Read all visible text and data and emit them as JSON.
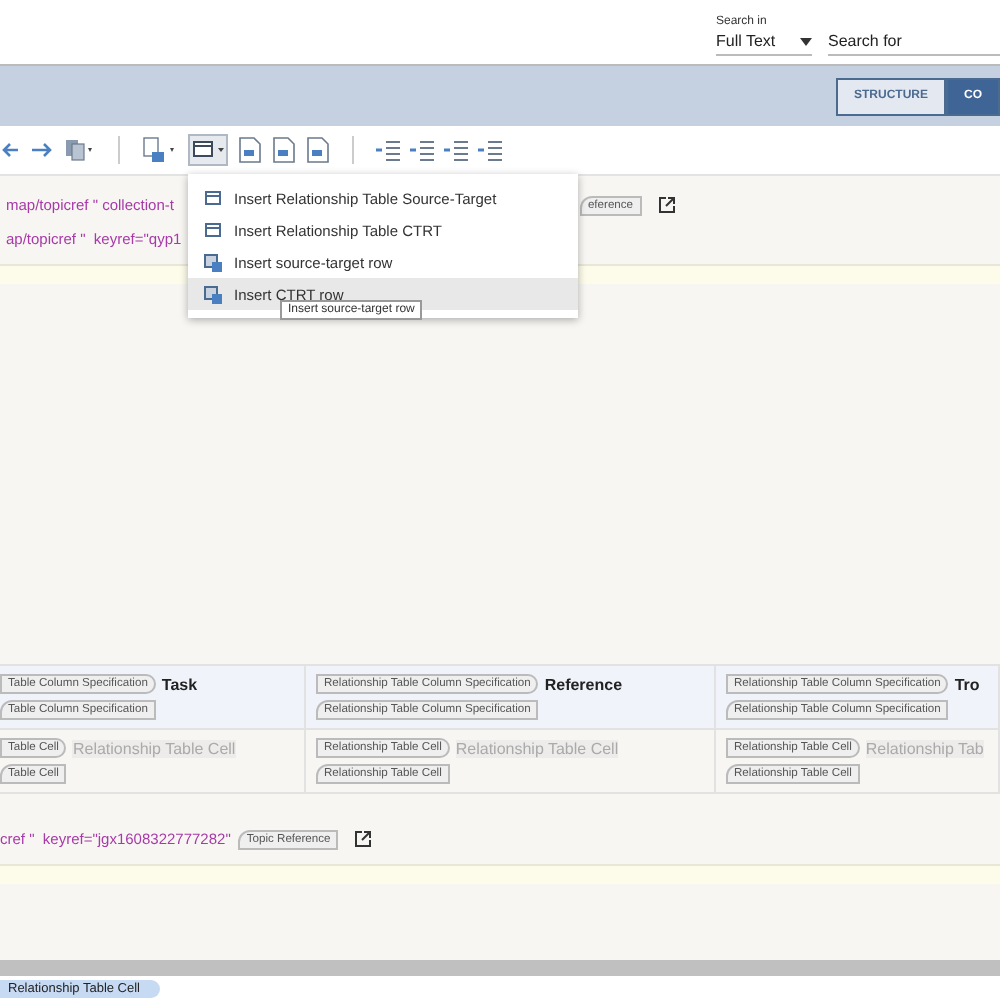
{
  "search": {
    "label": "Search in",
    "mode": "Full Text",
    "placeholder": "Search for"
  },
  "view_tabs": [
    {
      "label": "STRUCTURE",
      "selected": false
    },
    {
      "label": "CO",
      "selected": true
    }
  ],
  "editor_lines": [
    {
      "text": "map/topicref \" collection-t",
      "tag": "eference"
    },
    {
      "text": "ap/topicref \"  keyref=\"qyp1"
    }
  ],
  "rel_table": {
    "header": [
      {
        "start_tag": "Table Column Specification",
        "title": "Task",
        "end_tag": "Table Column Specification"
      },
      {
        "start_tag": "Relationship Table Column Specification",
        "title": "Reference",
        "end_tag": "Relationship Table Column Specification"
      },
      {
        "start_tag": "Relationship Table Column Specification",
        "title": "Tro",
        "end_tag": "Relationship Table Column Specification"
      }
    ],
    "row": [
      {
        "start_tag": "Table Cell",
        "text": "Relationship Table Cell",
        "end_tag": "Table Cell"
      },
      {
        "start_tag": "Relationship Table Cell",
        "text": "Relationship Table Cell",
        "end_tag": "Relationship Table Cell"
      },
      {
        "start_tag": "Relationship Table Cell",
        "text": "Relationship Tab",
        "end_tag": "Relationship Table Cell"
      }
    ]
  },
  "last_line": {
    "text": "cref \"  keyref=\"jgx1608322777282\"",
    "tag": "Topic Reference"
  },
  "breadcrumb": "Relationship Table Cell",
  "menu": {
    "items": [
      {
        "label": "Insert Relationship Table Source-Target",
        "selected": false
      },
      {
        "label": "Insert Relationship Table CTRT",
        "selected": false
      },
      {
        "label": "Insert source-target row",
        "selected": false
      },
      {
        "label": "Insert CTRT row",
        "selected": true
      }
    ],
    "tooltip": "Insert source-target row"
  }
}
